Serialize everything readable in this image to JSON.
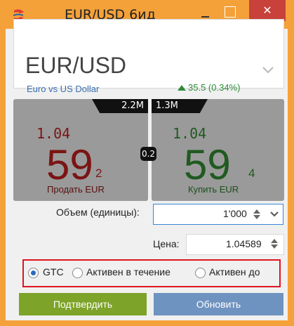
{
  "window": {
    "title": "EUR/USD 6ид",
    "close_glyph": "✕"
  },
  "header": {
    "pair": "EUR/USD",
    "description": "Euro vs US Dollar",
    "change": "35.5 (0.34%)",
    "change_color": "#2e8b3a"
  },
  "sell": {
    "liquidity": "2.2M",
    "price_prefix": "1.04",
    "price_big": "59",
    "price_sub": "2",
    "label": "Продать EUR"
  },
  "buy": {
    "liquidity": "1.3M",
    "price_prefix": "1.04",
    "price_big": "59",
    "price_sub": "4",
    "label": "Купить EUR"
  },
  "spread": "0.2",
  "volume": {
    "label": "Объем (единицы):",
    "value": "1'000"
  },
  "price": {
    "label": "Цена:",
    "value": "1.04589"
  },
  "time_in_force": {
    "options": [
      "GTC",
      "Активен в течение",
      "Активен до"
    ],
    "selected": "GTC"
  },
  "buttons": {
    "confirm": "Подтвердить",
    "update": "Обновить"
  },
  "colors": {
    "title_bar": "#f4a13a",
    "sell": "#7b1414",
    "buy": "#1f5a20",
    "confirm": "#7da328",
    "update": "#6f93c0",
    "highlight": "#e0141e"
  },
  "icons": [
    "app-logo-icon",
    "minimize-icon",
    "maximize-icon",
    "close-icon",
    "chevron-down-icon",
    "arrow-up-icon",
    "spin-up-icon",
    "spin-down-icon",
    "dropdown-arrow-icon"
  ]
}
